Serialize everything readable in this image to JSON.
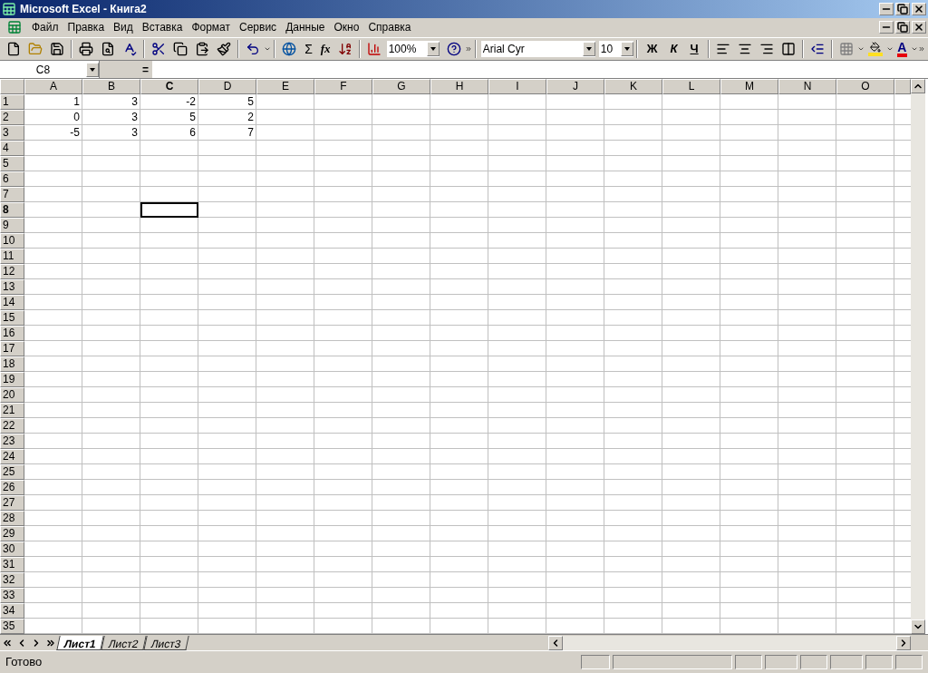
{
  "window": {
    "title": "Microsoft Excel - Книга2"
  },
  "menu": [
    "Файл",
    "Правка",
    "Вид",
    "Вставка",
    "Формат",
    "Сервис",
    "Данные",
    "Окно",
    "Справка"
  ],
  "toolbar": {
    "zoom": "100%",
    "sum": "Σ",
    "function": "fx",
    "font_color": "A",
    "font": "Arial Cyr",
    "font_size": "10",
    "bold": "Ж",
    "italic": "К",
    "underline": "Ч"
  },
  "formula_bar": {
    "name_box": "C8",
    "equals": "="
  },
  "columns": [
    {
      "label": "A",
      "selected": false
    },
    {
      "label": "B",
      "selected": false
    },
    {
      "label": "C",
      "selected": true
    },
    {
      "label": "D",
      "selected": false
    },
    {
      "label": "E",
      "selected": false
    },
    {
      "label": "F",
      "selected": false
    },
    {
      "label": "G",
      "selected": false
    },
    {
      "label": "H",
      "selected": false
    },
    {
      "label": "I",
      "selected": false
    },
    {
      "label": "J",
      "selected": false
    },
    {
      "label": "K",
      "selected": false
    },
    {
      "label": "L",
      "selected": false
    },
    {
      "label": "M",
      "selected": false
    },
    {
      "label": "N",
      "selected": false
    },
    {
      "label": "O",
      "selected": false
    }
  ],
  "rows": [
    {
      "label": "1",
      "selected": false,
      "cells": [
        "1",
        "3",
        "-2",
        "5"
      ]
    },
    {
      "label": "2",
      "selected": false,
      "cells": [
        "0",
        "3",
        "5",
        "2"
      ]
    },
    {
      "label": "3",
      "selected": false,
      "cells": [
        "-5",
        "3",
        "6",
        "7"
      ]
    },
    {
      "label": "4",
      "selected": false
    },
    {
      "label": "5",
      "selected": false
    },
    {
      "label": "6",
      "selected": false
    },
    {
      "label": "7",
      "selected": false
    },
    {
      "label": "8",
      "selected": true
    },
    {
      "label": "9",
      "selected": false
    },
    {
      "label": "10",
      "selected": false
    },
    {
      "label": "11",
      "selected": false
    },
    {
      "label": "12",
      "selected": false
    },
    {
      "label": "13",
      "selected": false
    },
    {
      "label": "14",
      "selected": false
    },
    {
      "label": "15",
      "selected": false
    },
    {
      "label": "16",
      "selected": false
    },
    {
      "label": "17",
      "selected": false
    },
    {
      "label": "18",
      "selected": false
    },
    {
      "label": "19",
      "selected": false
    },
    {
      "label": "20",
      "selected": false
    },
    {
      "label": "21",
      "selected": false
    },
    {
      "label": "22",
      "selected": false
    },
    {
      "label": "23",
      "selected": false
    },
    {
      "label": "24",
      "selected": false
    },
    {
      "label": "25",
      "selected": false
    },
    {
      "label": "26",
      "selected": false
    },
    {
      "label": "27",
      "selected": false
    },
    {
      "label": "28",
      "selected": false
    },
    {
      "label": "29",
      "selected": false
    },
    {
      "label": "30",
      "selected": false
    },
    {
      "label": "31",
      "selected": false
    },
    {
      "label": "32",
      "selected": false
    },
    {
      "label": "33",
      "selected": false
    },
    {
      "label": "34",
      "selected": false
    },
    {
      "label": "35",
      "selected": false
    }
  ],
  "sheet_tabs": [
    {
      "label": "Лист1",
      "selected": true
    },
    {
      "label": "Лист2",
      "selected": false
    },
    {
      "label": "Лист3",
      "selected": false
    }
  ],
  "status_bar": {
    "text": "Готово"
  }
}
